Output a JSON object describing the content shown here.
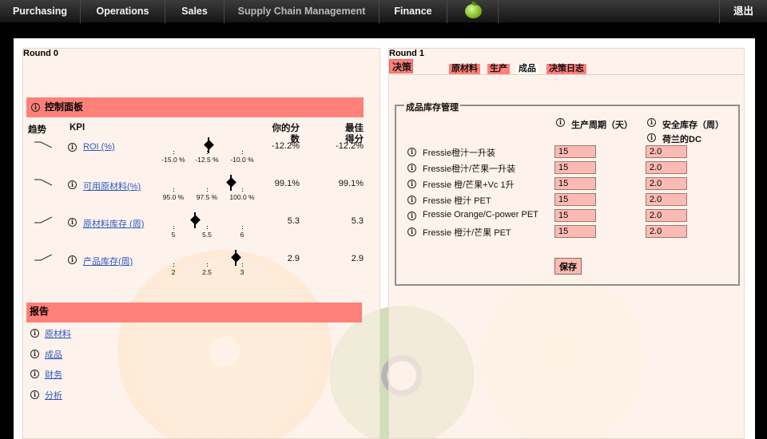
{
  "nav": {
    "items": [
      "Purchasing",
      "Operations",
      "Sales",
      "Supply Chain Management",
      "Finance"
    ],
    "exit": "退出",
    "logo_icon": "apple-logo-icon"
  },
  "left": {
    "round_title": "Round 0",
    "control_title": "控制面板",
    "headers": {
      "trend": "趋势",
      "kpi": "KPI",
      "your_score": "你的分数",
      "best_score": "最佳得分"
    },
    "kpis": [
      {
        "label": "ROI (%)",
        "your": "-12.2%",
        "best": "-12.2%",
        "trend": "down",
        "ticks": [
          "-15.0 %",
          "-12.5 %",
          "-10.0 %"
        ],
        "marker_fraction": 0.5
      },
      {
        "label": "可用原材料(%)",
        "your": "99.1%",
        "best": "99.1%",
        "trend": "down",
        "ticks": [
          "95.0 %",
          "97.5 %",
          "100.0 %"
        ],
        "marker_fraction": 0.82
      },
      {
        "label": "原材料库存 (周)",
        "your": "5.3",
        "best": "5.3",
        "trend": "up",
        "ticks": [
          "5",
          "5.5",
          "6"
        ],
        "marker_fraction": 0.3
      },
      {
        "label": "产品库存(周)",
        "your": "2.9",
        "best": "2.9",
        "trend": "up",
        "ticks": [
          "2",
          "2.5",
          "3"
        ],
        "marker_fraction": 0.9
      }
    ],
    "reports_title": "报告",
    "reports": [
      "原材料",
      "成品",
      "财务",
      "分析"
    ]
  },
  "right": {
    "round_title": "Round 1",
    "decision_tab": "决策",
    "sub_tabs": [
      "原材料",
      "生产",
      "成品",
      "决策日志"
    ],
    "active_sub_tab": "成品",
    "fieldset_title": "成品库存管理",
    "col_production_cycle": "生产周期（天）",
    "col_safety_stock": "安全库存（周）",
    "col_safety_sub": "荷兰的DC",
    "rows": [
      {
        "name": "Fressie橙汁一升装",
        "cycle": "15",
        "safety": "2.0"
      },
      {
        "name": "Fressie橙汁/芒果一升装",
        "cycle": "15",
        "safety": "2.0"
      },
      {
        "name": "Fressie 橙/芒果+Vc 1升",
        "cycle": "15",
        "safety": "2.0"
      },
      {
        "name": "Fressie 橙汁 PET",
        "cycle": "15",
        "safety": "2.0"
      },
      {
        "name": "Fressie Orange/C-power PET",
        "cycle": "15",
        "safety": "2.0"
      },
      {
        "name": "Fressie 橙汁/芒果 PET",
        "cycle": "15",
        "safety": "2.0"
      }
    ],
    "save_label": "保存"
  },
  "colors": {
    "accent_red": "#fe8079",
    "input_fill": "#fbbab2",
    "panel_bg": "#fdeee4",
    "link_blue": "#2b56c5"
  }
}
